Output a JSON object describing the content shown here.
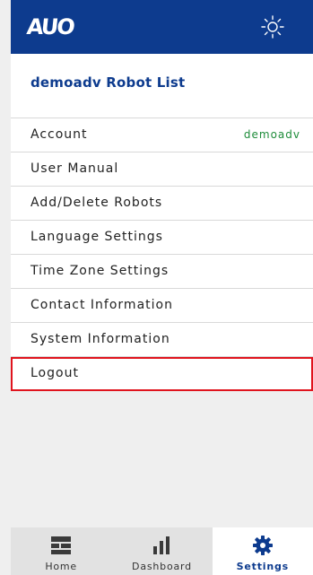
{
  "header": {
    "logo_text": "AUO",
    "theme_icon": "sun-icon",
    "brand_color": "#0d3b8e"
  },
  "list_title": "demoadv Robot List",
  "menu": {
    "account": {
      "label": "Account",
      "value": "demoadv"
    },
    "user_manual": {
      "label": "User Manual"
    },
    "add_delete_robots": {
      "label": "Add/Delete Robots"
    },
    "language_settings": {
      "label": "Language Settings"
    },
    "time_zone_settings": {
      "label": "Time Zone Settings"
    },
    "contact_information": {
      "label": "Contact Information"
    },
    "system_information": {
      "label": "System Information"
    },
    "logout": {
      "label": "Logout",
      "highlight_color": "#e0141e"
    }
  },
  "bottom_nav": {
    "home": {
      "label": "Home",
      "icon": "home-grid-icon"
    },
    "dashboard": {
      "label": "Dashboard",
      "icon": "bar-chart-icon"
    },
    "settings": {
      "label": "Settings",
      "icon": "gear-icon",
      "active": true
    }
  }
}
